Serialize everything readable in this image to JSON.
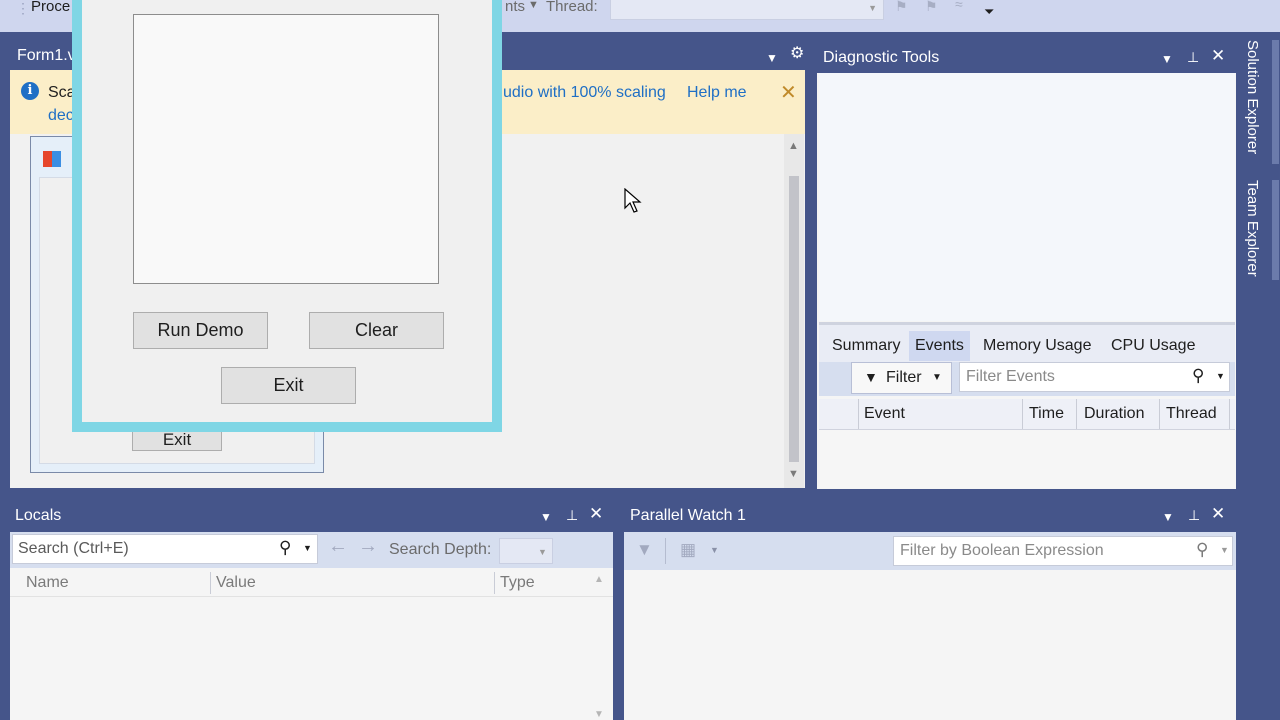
{
  "toolbar": {
    "process_label": "Proce",
    "events_label": "nts",
    "thread_label": "Thread:"
  },
  "document": {
    "tab_title": "Form1.v"
  },
  "infobar": {
    "message_start": "Sca",
    "message_line2": "dec",
    "message_end": "udio with 100% scaling",
    "help_link": "Help me"
  },
  "designer_form": {
    "exit_label": "Exit"
  },
  "form_window": {
    "run_demo_label": "Run Demo",
    "clear_label": "Clear",
    "exit_label": "Exit"
  },
  "diagnostic_tools": {
    "title": "Diagnostic Tools",
    "tabs": [
      "Summary",
      "Events",
      "Memory Usage",
      "CPU Usage"
    ],
    "selected_tab": "Events",
    "filter_label": "Filter",
    "filter_placeholder": "Filter Events",
    "columns": [
      "Event",
      "Time",
      "Duration",
      "Thread"
    ]
  },
  "sidebar": {
    "solution_explorer": "Solution Explorer",
    "team_explorer": "Team Explorer"
  },
  "locals": {
    "title": "Locals",
    "search_placeholder": "Search (Ctrl+E)",
    "search_depth_label": "Search Depth:",
    "columns": [
      "Name",
      "Value",
      "Type"
    ]
  },
  "parallel_watch": {
    "title": "Parallel Watch 1",
    "filter_placeholder": "Filter by Boolean Expression"
  },
  "colors": {
    "frame": "#45558a",
    "form_border": "#7fd6e5",
    "infobar": "#fbeec8",
    "link": "#1f6fc5"
  }
}
